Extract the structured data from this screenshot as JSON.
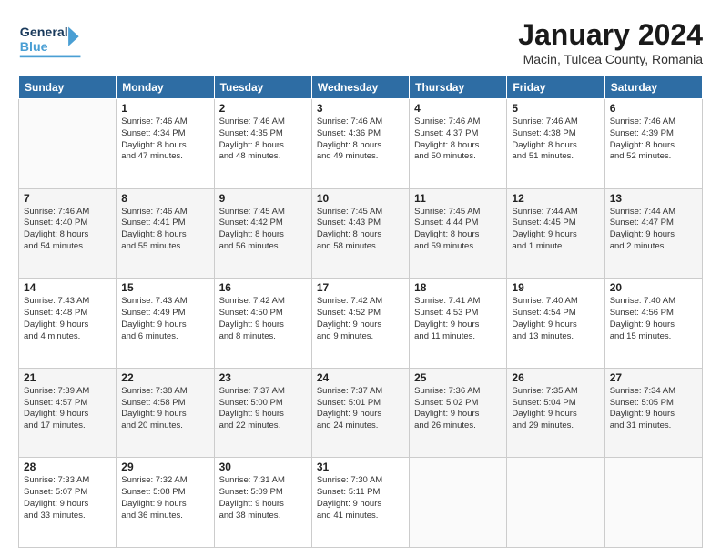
{
  "header": {
    "logo_general": "General",
    "logo_blue": "Blue",
    "title": "January 2024",
    "subtitle": "Macin, Tulcea County, Romania"
  },
  "days_of_week": [
    "Sunday",
    "Monday",
    "Tuesday",
    "Wednesday",
    "Thursday",
    "Friday",
    "Saturday"
  ],
  "weeks": [
    [
      {
        "day": "",
        "info": ""
      },
      {
        "day": "1",
        "info": "Sunrise: 7:46 AM\nSunset: 4:34 PM\nDaylight: 8 hours\nand 47 minutes."
      },
      {
        "day": "2",
        "info": "Sunrise: 7:46 AM\nSunset: 4:35 PM\nDaylight: 8 hours\nand 48 minutes."
      },
      {
        "day": "3",
        "info": "Sunrise: 7:46 AM\nSunset: 4:36 PM\nDaylight: 8 hours\nand 49 minutes."
      },
      {
        "day": "4",
        "info": "Sunrise: 7:46 AM\nSunset: 4:37 PM\nDaylight: 8 hours\nand 50 minutes."
      },
      {
        "day": "5",
        "info": "Sunrise: 7:46 AM\nSunset: 4:38 PM\nDaylight: 8 hours\nand 51 minutes."
      },
      {
        "day": "6",
        "info": "Sunrise: 7:46 AM\nSunset: 4:39 PM\nDaylight: 8 hours\nand 52 minutes."
      }
    ],
    [
      {
        "day": "7",
        "info": "Sunrise: 7:46 AM\nSunset: 4:40 PM\nDaylight: 8 hours\nand 54 minutes."
      },
      {
        "day": "8",
        "info": "Sunrise: 7:46 AM\nSunset: 4:41 PM\nDaylight: 8 hours\nand 55 minutes."
      },
      {
        "day": "9",
        "info": "Sunrise: 7:45 AM\nSunset: 4:42 PM\nDaylight: 8 hours\nand 56 minutes."
      },
      {
        "day": "10",
        "info": "Sunrise: 7:45 AM\nSunset: 4:43 PM\nDaylight: 8 hours\nand 58 minutes."
      },
      {
        "day": "11",
        "info": "Sunrise: 7:45 AM\nSunset: 4:44 PM\nDaylight: 8 hours\nand 59 minutes."
      },
      {
        "day": "12",
        "info": "Sunrise: 7:44 AM\nSunset: 4:45 PM\nDaylight: 9 hours\nand 1 minute."
      },
      {
        "day": "13",
        "info": "Sunrise: 7:44 AM\nSunset: 4:47 PM\nDaylight: 9 hours\nand 2 minutes."
      }
    ],
    [
      {
        "day": "14",
        "info": "Sunrise: 7:43 AM\nSunset: 4:48 PM\nDaylight: 9 hours\nand 4 minutes."
      },
      {
        "day": "15",
        "info": "Sunrise: 7:43 AM\nSunset: 4:49 PM\nDaylight: 9 hours\nand 6 minutes."
      },
      {
        "day": "16",
        "info": "Sunrise: 7:42 AM\nSunset: 4:50 PM\nDaylight: 9 hours\nand 8 minutes."
      },
      {
        "day": "17",
        "info": "Sunrise: 7:42 AM\nSunset: 4:52 PM\nDaylight: 9 hours\nand 9 minutes."
      },
      {
        "day": "18",
        "info": "Sunrise: 7:41 AM\nSunset: 4:53 PM\nDaylight: 9 hours\nand 11 minutes."
      },
      {
        "day": "19",
        "info": "Sunrise: 7:40 AM\nSunset: 4:54 PM\nDaylight: 9 hours\nand 13 minutes."
      },
      {
        "day": "20",
        "info": "Sunrise: 7:40 AM\nSunset: 4:56 PM\nDaylight: 9 hours\nand 15 minutes."
      }
    ],
    [
      {
        "day": "21",
        "info": "Sunrise: 7:39 AM\nSunset: 4:57 PM\nDaylight: 9 hours\nand 17 minutes."
      },
      {
        "day": "22",
        "info": "Sunrise: 7:38 AM\nSunset: 4:58 PM\nDaylight: 9 hours\nand 20 minutes."
      },
      {
        "day": "23",
        "info": "Sunrise: 7:37 AM\nSunset: 5:00 PM\nDaylight: 9 hours\nand 22 minutes."
      },
      {
        "day": "24",
        "info": "Sunrise: 7:37 AM\nSunset: 5:01 PM\nDaylight: 9 hours\nand 24 minutes."
      },
      {
        "day": "25",
        "info": "Sunrise: 7:36 AM\nSunset: 5:02 PM\nDaylight: 9 hours\nand 26 minutes."
      },
      {
        "day": "26",
        "info": "Sunrise: 7:35 AM\nSunset: 5:04 PM\nDaylight: 9 hours\nand 29 minutes."
      },
      {
        "day": "27",
        "info": "Sunrise: 7:34 AM\nSunset: 5:05 PM\nDaylight: 9 hours\nand 31 minutes."
      }
    ],
    [
      {
        "day": "28",
        "info": "Sunrise: 7:33 AM\nSunset: 5:07 PM\nDaylight: 9 hours\nand 33 minutes."
      },
      {
        "day": "29",
        "info": "Sunrise: 7:32 AM\nSunset: 5:08 PM\nDaylight: 9 hours\nand 36 minutes."
      },
      {
        "day": "30",
        "info": "Sunrise: 7:31 AM\nSunset: 5:09 PM\nDaylight: 9 hours\nand 38 minutes."
      },
      {
        "day": "31",
        "info": "Sunrise: 7:30 AM\nSunset: 5:11 PM\nDaylight: 9 hours\nand 41 minutes."
      },
      {
        "day": "",
        "info": ""
      },
      {
        "day": "",
        "info": ""
      },
      {
        "day": "",
        "info": ""
      }
    ]
  ]
}
